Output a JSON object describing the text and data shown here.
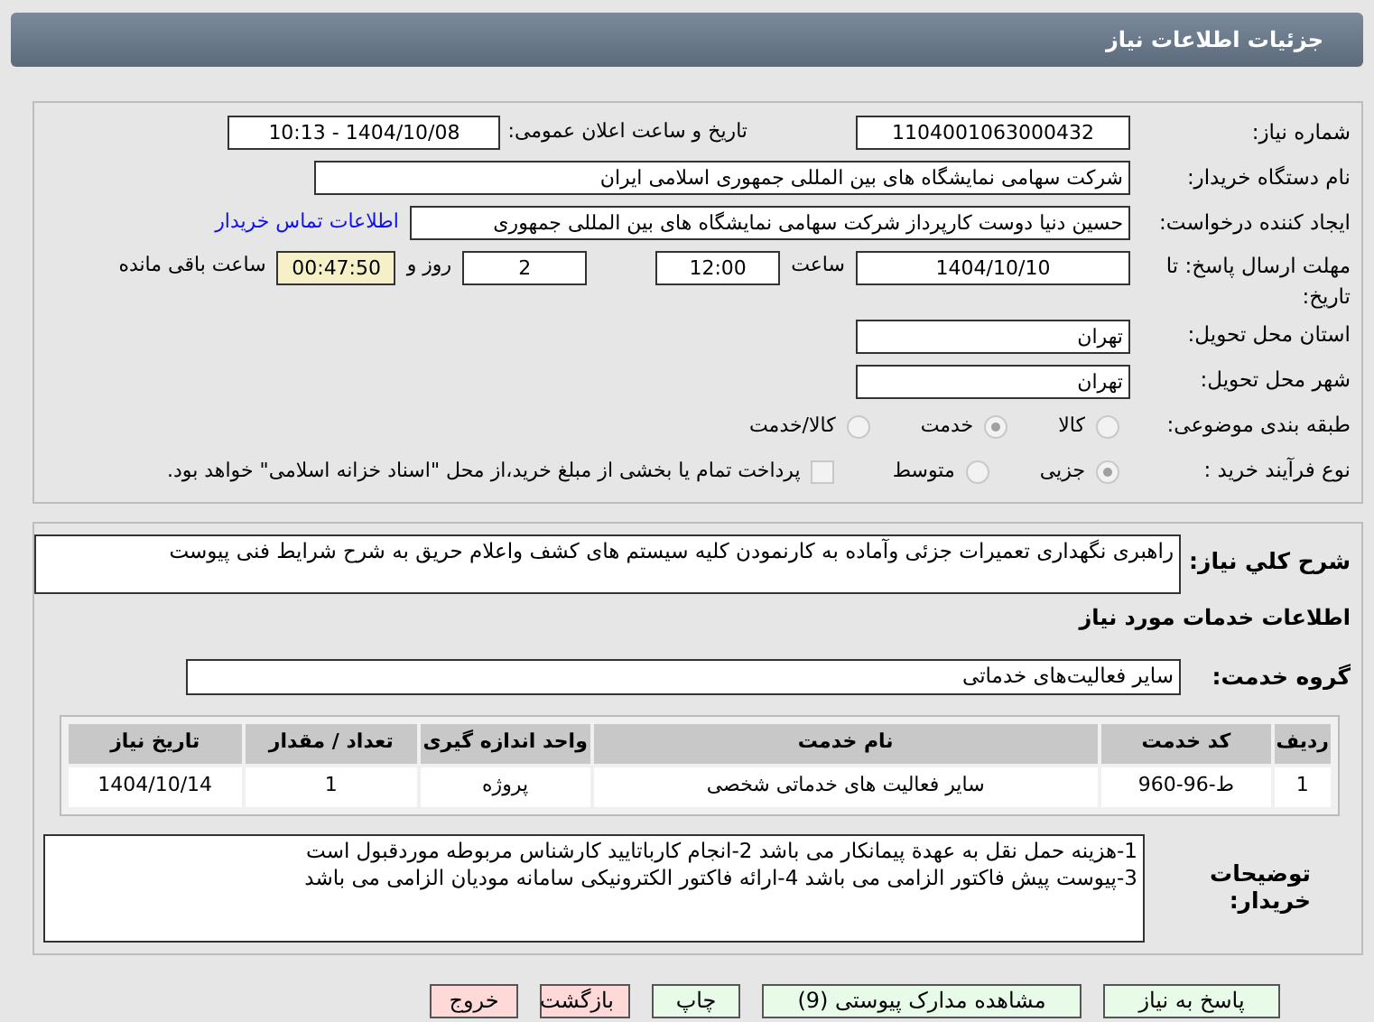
{
  "header": {
    "title": "جزئیات اطلاعات نیاز"
  },
  "need_info": {
    "need_number": {
      "label": "شماره نیاز:",
      "value": "1104001063000432"
    },
    "announce": {
      "label": "تاریخ و ساعت اعلان عمومی:",
      "value": "1404/10/08 - 10:13"
    },
    "buyer": {
      "label": "نام دستگاه خریدار:",
      "value": "شرکت سهامی نمایشگاه های بین المللی جمهوری اسلامی ایران"
    },
    "creator": {
      "label": "ایجاد کننده درخواست:",
      "value": "حسین دنیا دوست کارپرداز شرکت سهامی نمایشگاه های بین المللی جمهوری",
      "link": "اطلاعات تماس خریدار"
    },
    "deadline": {
      "label": "مهلت ارسال پاسخ: تا تاریخ:",
      "date": "1404/10/10",
      "time_label": "ساعت",
      "time": "12:00",
      "days": "2",
      "days_label": "روز و",
      "remaining": "00:47:50",
      "remaining_label": "ساعت باقی مانده"
    },
    "province": {
      "label": "استان محل تحویل:",
      "value": "تهران"
    },
    "city": {
      "label": "شهر محل تحویل:",
      "value": "تهران"
    },
    "category": {
      "label": "طبقه بندی موضوعی:",
      "options": [
        {
          "label": "کالا",
          "selected": false
        },
        {
          "label": "خدمت",
          "selected": true
        },
        {
          "label": "کالا/خدمت",
          "selected": false
        }
      ]
    },
    "process": {
      "label": "نوع فرآیند خرید :",
      "options": [
        {
          "label": "جزیی",
          "selected": true
        },
        {
          "label": "متوسط",
          "selected": false
        }
      ],
      "treasury": {
        "checked": false,
        "label": "پرداخت تمام یا بخشی از مبلغ خرید،از محل \"اسناد خزانه اسلامی\" خواهد بود."
      }
    }
  },
  "services": {
    "summary": {
      "label": "شرح کلي نیاز:",
      "value": "راهبری نگهداری تعمیرات جزئی وآماده به کارنمودن کلیه سیستم های کشف واعلام حریق به شرح شرایط فنی پیوست"
    },
    "heading": "اطلاعات خدمات مورد نیاز",
    "group": {
      "label": "گروه خدمت:",
      "value": "سایر فعالیت‌های خدماتی"
    },
    "table": {
      "columns": [
        "ردیف",
        "کد خدمت",
        "نام خدمت",
        "واحد اندازه گیری",
        "تعداد / مقدار",
        "تاریخ نیاز"
      ],
      "rows": [
        [
          "1",
          "ط-96-960",
          "سایر فعالیت های خدماتی شخصی",
          "پروژه",
          "1",
          "1404/10/14"
        ]
      ]
    },
    "notes": {
      "label": "توضیحات خریدار:",
      "lines": [
        "1-هزینه حمل نقل به عهدة پیمانکار می باشد 2-انجام کارباتایید کارشناس مربوطه موردقبول است",
        "3-پیوست پیش فاکتور الزامی می باشد 4-ارائه فاکتور الکترونیکی سامانه مودیان الزامی می باشد"
      ]
    }
  },
  "buttons": [
    {
      "label": "پاسخ به نیاز",
      "kind": "green"
    },
    {
      "label": "مشاهده مدارک پیوستی (9)",
      "kind": "green"
    },
    {
      "label": "چاپ",
      "kind": "green"
    },
    {
      "label": "بازگشت",
      "kind": "red"
    },
    {
      "label": "خروج",
      "kind": "red"
    }
  ]
}
